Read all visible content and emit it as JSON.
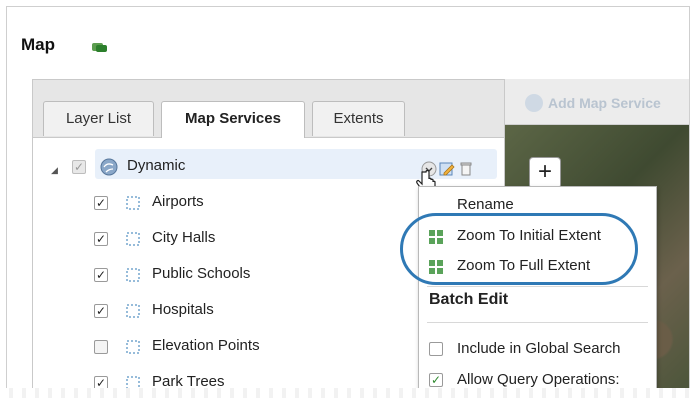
{
  "app": {
    "title": "Map"
  },
  "tabs": [
    {
      "label": "Layer List",
      "active": false
    },
    {
      "label": "Map Services",
      "active": true
    },
    {
      "label": "Extents",
      "active": false
    }
  ],
  "map_toolbar": {
    "add_service_label": "Add Map Service"
  },
  "tree": {
    "root": {
      "label": "Dynamic",
      "checked": true,
      "icon": "globe-icon"
    },
    "layers": [
      {
        "label": "Airports",
        "checked": true
      },
      {
        "label": "City Halls",
        "checked": true
      },
      {
        "label": "Public Schools",
        "checked": true
      },
      {
        "label": "Hospitals",
        "checked": true
      },
      {
        "label": "Elevation Points",
        "checked": false
      },
      {
        "label": "Park Trees",
        "checked": true
      }
    ]
  },
  "context_menu": {
    "items": [
      {
        "label": "Rename"
      },
      {
        "label": "Zoom To Initial Extent",
        "icon": "zoom-extent-icon"
      },
      {
        "label": "Zoom To Full Extent",
        "icon": "zoom-extent-icon"
      }
    ],
    "section_title": "Batch Edit",
    "options": [
      {
        "label": "Include in Global Search",
        "checked": false
      },
      {
        "label": "Allow Query Operations:",
        "checked": true
      }
    ]
  },
  "map": {
    "zoom_in_label": "+"
  },
  "colors": {
    "accent": "#2f79b5",
    "selected_row": "#e8f0fa",
    "zoom_icon": "#5aa35a"
  }
}
